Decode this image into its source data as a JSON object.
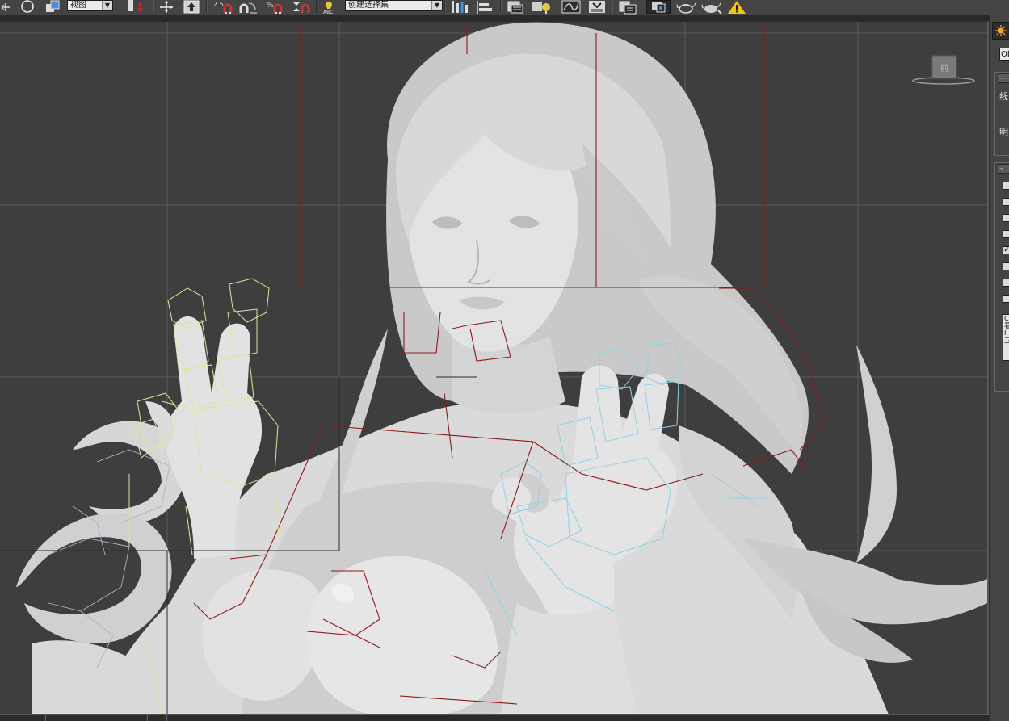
{
  "toolbar": {
    "view_dropdown": "视图",
    "selection_set_dropdown": "创建选择集",
    "snap_2d_label": "2.5",
    "percent_snap_label": "%",
    "named_selection_abc": "ABC"
  },
  "command_panel": {
    "object_type_field": "Ob",
    "rollout_minus_1": "-",
    "rollout_minus_2": "-",
    "label_1": "线",
    "label_2": "明",
    "checkboxes": [
      false,
      false,
      false,
      false,
      true,
      false,
      false,
      false
    ],
    "check_mark": "✓",
    "textbox_content": "C\n看\nI\n卫"
  },
  "viewcube": {
    "face_label": "前"
  },
  "colors": {
    "viewport_bg": "#3e3e3e",
    "grid": "#595959",
    "bone_red": "#8b1a1a",
    "bone_yellow": "#dfe69a",
    "bone_cyan": "#8fd3e6",
    "mesh": "#d9d9d9",
    "warning": "#f2c21b"
  }
}
